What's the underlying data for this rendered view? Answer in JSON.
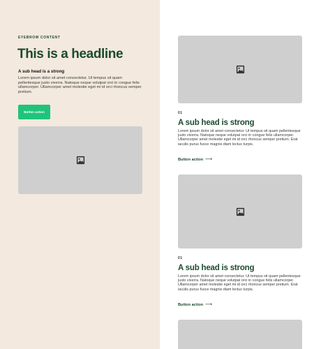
{
  "hero": {
    "eyebrow": "EYEBROW CONTENT",
    "headline": "This is a headline",
    "subhead": "A sub head is a strong",
    "body": "Lorem ipsum dolor sit amet consectetur. Ut tempus sit quam pellentesque justo viverra. Natoque neque volutpat orci in congue felis ullamcorper. Ullamcorper amet molestie eget mi id orci rhoncus semper pretium.",
    "button_label": "Button action",
    "image_icon": "image-icon"
  },
  "cards": [
    {
      "number": "01",
      "title": "A sub head is strong",
      "body": "Lorem ipsum dolor sit amet consectetur. Ut tempus sit quam pellentesque justo viverra. Natoque neque volutpat orci in congue felis ullamcorper. Ullamcorper amet molestie eget mi id orci rhoncus semper pretium. Erat iaculis purus fusce magnis diam lectus turpis.",
      "link_label": "Button action",
      "link_arrow": "⟶",
      "image_icon": "image-icon"
    },
    {
      "number": "01",
      "title": "A sub head is strong",
      "body": "Lorem ipsum dolor sit amet consectetur. Ut tempus sit quam pellentesque justo viverra. Natoque neque volutpat orci in congue felis ullamcorper. Ullamcorper amet molestie eget mi id orci rhoncus semper pretium. Erat iaculis purus fusce magnis diam lectus turpis.",
      "link_label": "Button action",
      "link_arrow": "⟶",
      "image_icon": "image-icon"
    }
  ],
  "colors": {
    "left_panel_bg": "#f3e9de",
    "headline": "#1d4a2e",
    "button_bg": "#1fc47a",
    "image_placeholder": "#cfcfcf"
  }
}
